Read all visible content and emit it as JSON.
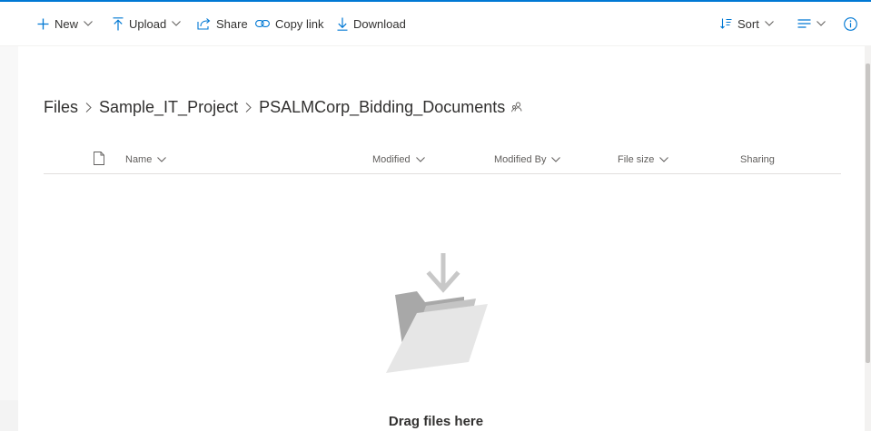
{
  "command_bar": {
    "new_label": "New",
    "upload_label": "Upload",
    "share_label": "Share",
    "copy_link_label": "Copy link",
    "download_label": "Download",
    "sort_label": "Sort"
  },
  "breadcrumb": {
    "items": [
      "Files",
      "Sample_IT_Project",
      "PSALMCorp_Bidding_Documents"
    ]
  },
  "columns": {
    "name": "Name",
    "modified": "Modified",
    "modified_by": "Modified By",
    "file_size": "File size",
    "sharing": "Sharing"
  },
  "empty_state": {
    "text": "Drag files here"
  },
  "colors": {
    "accent": "#0078d4",
    "text": "#323130",
    "muted": "#605e5c"
  }
}
